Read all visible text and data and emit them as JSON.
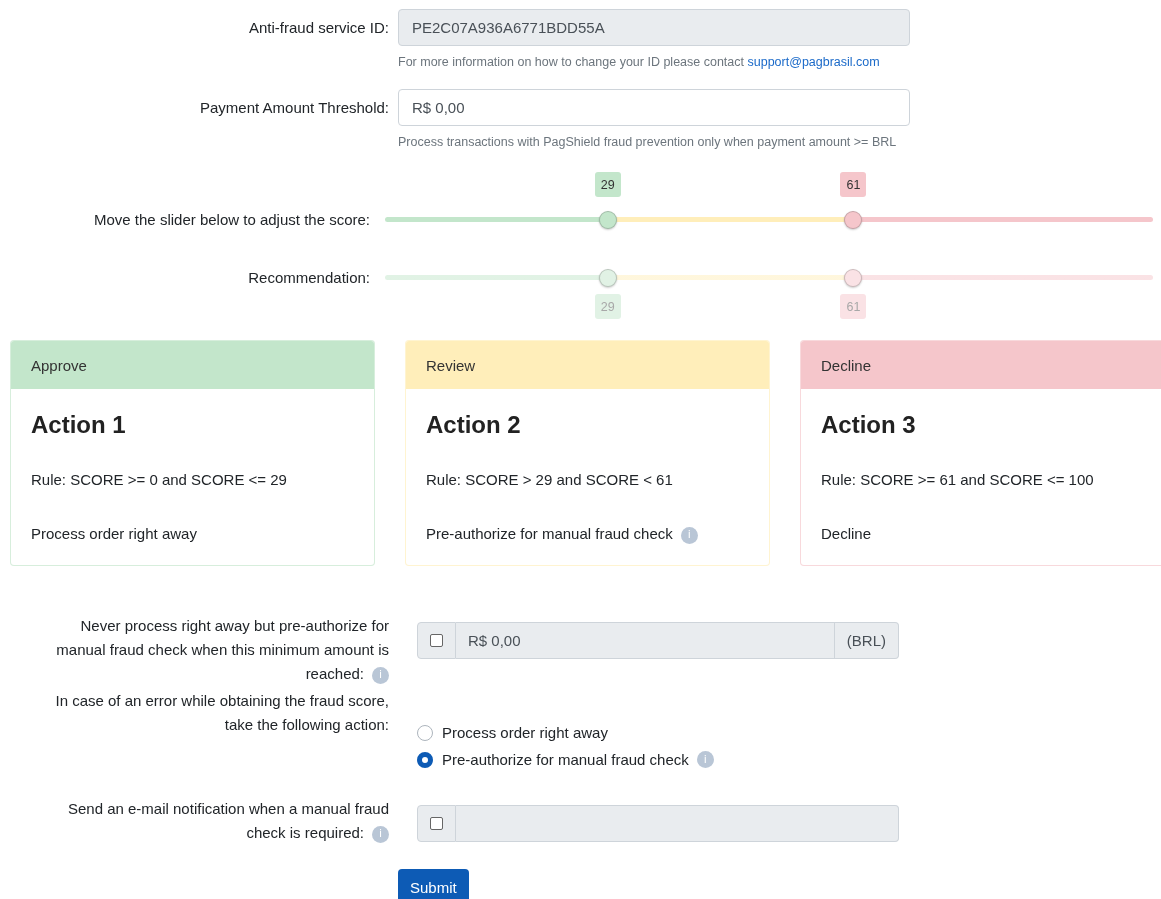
{
  "fields": [
    {
      "label": "Anti-fraud service ID:",
      "value": "PE2C07A936A6771BDD55A",
      "readonly": true,
      "help": "For more information on how to change your ID please contact ",
      "help_link": "support@pagbrasil.com"
    },
    {
      "label": "Payment Amount Threshold:",
      "value": "R$ 0,00",
      "readonly": false,
      "help": "Process transactions with PagShield fraud prevention only when payment amount >= BRL"
    }
  ],
  "sliders": [
    {
      "kind": "score",
      "label": "Move the slider below to adjust the score:",
      "disabled": false,
      "handles": [
        {
          "reading": "29",
          "level": 0.29,
          "color": "#c3e6cb"
        },
        {
          "reading": "61",
          "level": 0.61,
          "color": "#f5c6cb"
        }
      ]
    },
    {
      "kind": "recommendation",
      "label": "Recommendation:",
      "disabled": true,
      "handles": [
        {
          "reading": "29",
          "level": 0.29,
          "color": "#e1f2e5"
        },
        {
          "reading": "61",
          "level": 0.61,
          "color": "#fae2e5"
        }
      ]
    }
  ],
  "cards": [
    {
      "header": "Approve",
      "color": "#c3e6cb",
      "title": "Action 1",
      "rule": "Rule: SCORE >= 0 and SCORE <= 29",
      "action": "Process order right away"
    },
    {
      "header": "Review",
      "color": "#ffeeba",
      "title": "Action 2",
      "rule": "Rule: SCORE > 29 and SCORE < 61",
      "action": "Pre-authorize for manual fraud check",
      "info": "i"
    },
    {
      "header": "Decline",
      "color": "#f5c6cb",
      "title": "Action 3",
      "rule": "Rule: SCORE >= 61 and SCORE <= 100",
      "action": "Decline"
    }
  ],
  "settings": [
    {
      "kind": "amount",
      "label": "Never process right away but pre-authorize for manual fraud check when this minimum amount is reached:",
      "info": "i",
      "checked": false,
      "value": "R$ 0,00",
      "addon": "(BRL)"
    },
    {
      "kind": "radio",
      "label": "In case of an error while obtaining the fraud score, take the following action:",
      "options": [
        {
          "label": "Process order right away",
          "selected": false
        },
        {
          "label": "Pre-authorize for manual fraud check",
          "selected": true,
          "info": "i"
        }
      ]
    },
    {
      "kind": "email",
      "label": "Send an e-mail notification when a manual fraud check is required:",
      "info": "i",
      "checked": false
    }
  ],
  "submit": "Submit"
}
